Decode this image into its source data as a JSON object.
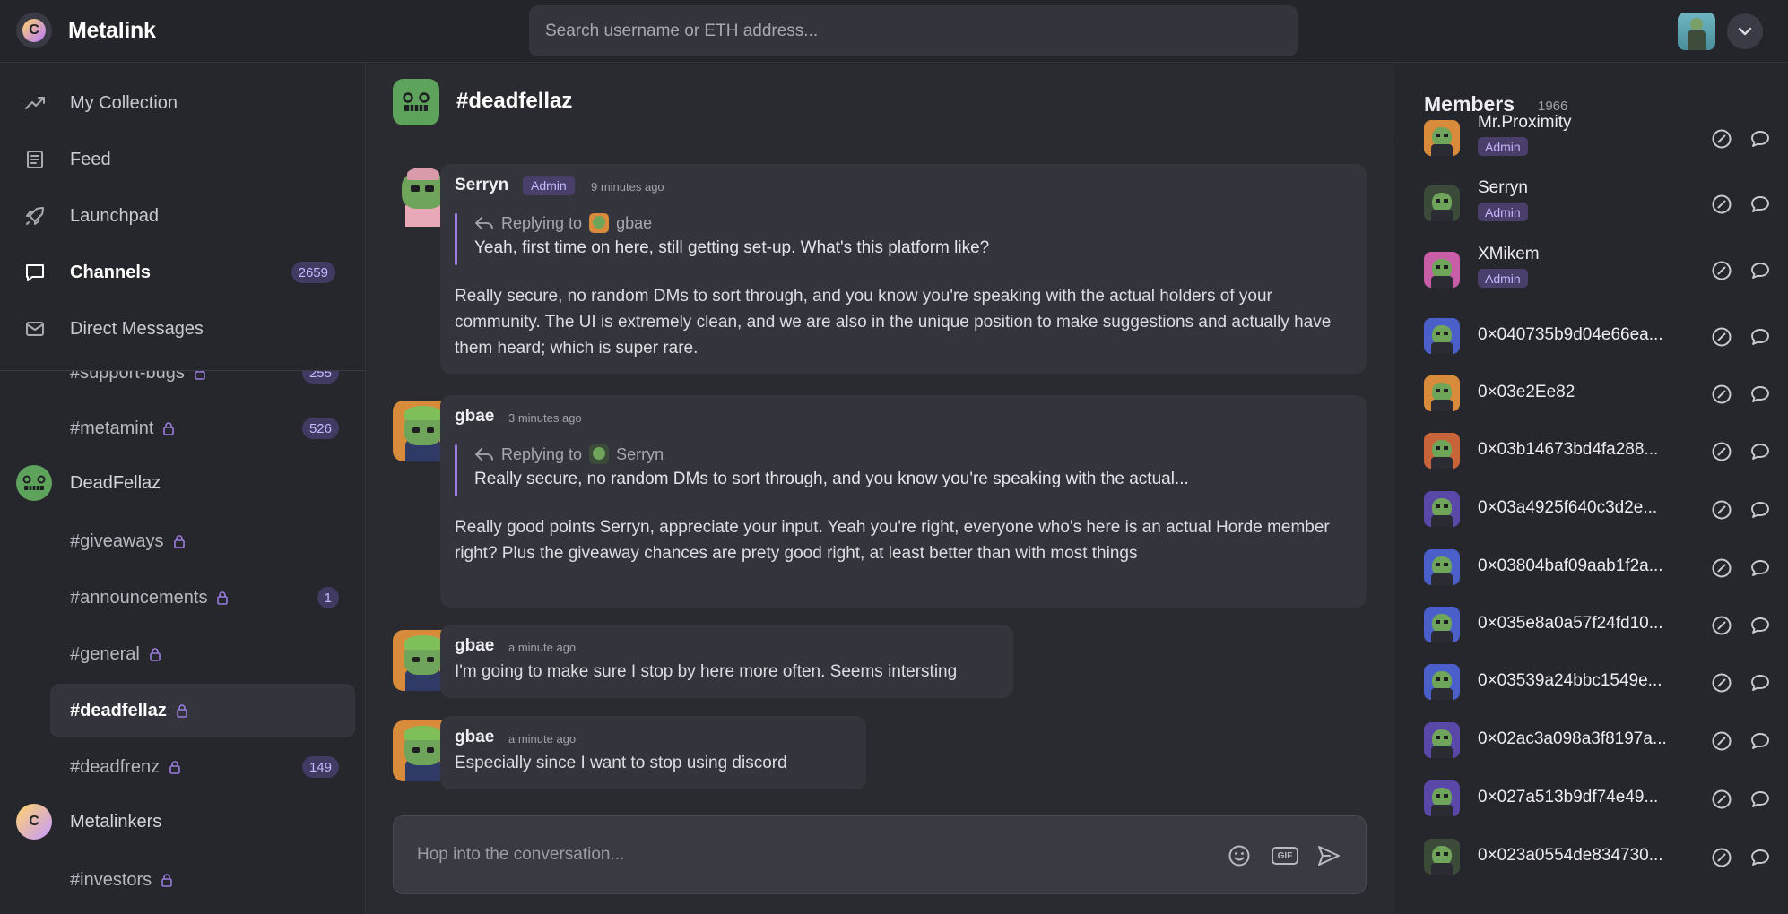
{
  "app": {
    "brand": "Metalink",
    "logo_icon": "metalink-logo-icon",
    "search_placeholder": "Search username or ETH address..."
  },
  "colors": {
    "accent": "#9b7ce0",
    "badge_bg": "#4a3f6b",
    "badge_text": "#c9b6ff",
    "background": "#26262d"
  },
  "nav": [
    {
      "label": "My Collection",
      "icon": "trending-up-icon"
    },
    {
      "label": "Feed",
      "icon": "newspaper-icon"
    },
    {
      "label": "Launchpad",
      "icon": "rocket-icon"
    },
    {
      "label": "Channels",
      "icon": "chat-bubble-icon",
      "count": "2659"
    },
    {
      "label": "Direct Messages",
      "icon": "mail-icon"
    }
  ],
  "channel_list": {
    "partial_top": {
      "name": "#support-bugs",
      "count": "255"
    },
    "metamint": {
      "name": "#metamint",
      "count": "526"
    },
    "group_deadfellaz": "DeadFellaz",
    "giveaways": {
      "name": "#giveaways"
    },
    "announcements": {
      "name": "#announcements",
      "count": "1"
    },
    "general": {
      "name": "#general"
    },
    "deadfellaz": {
      "name": "#deadfellaz"
    },
    "deadfrenz": {
      "name": "#deadfrenz",
      "count": "149"
    },
    "group_metalinkers": "Metalinkers",
    "investors": {
      "name": "#investors"
    }
  },
  "chat": {
    "channel_title": "#deadfellaz",
    "messages": [
      {
        "author": "Serryn",
        "role": "Admin",
        "time": "9 minutes ago",
        "reply_prefix": "Replying to",
        "reply_user": "gbae",
        "reply_text": "Yeah, first time on here, still getting set-up. What's this platform like?",
        "body": "Really secure, no random DMs to sort through, and you know you're speaking with the actual holders of your community. The UI is extremely clean, and we are also in the unique position to make suggestions and actually have them heard; which is super rare."
      },
      {
        "author": "gbae",
        "time": "3 minutes ago",
        "reply_prefix": "Replying to",
        "reply_user": "Serryn",
        "reply_text": "Really secure, no random DMs to sort through, and you know you're speaking with the actual...",
        "body": "Really good points Serryn, appreciate your input. Yeah you're right, everyone who's here is an actual Horde member right? Plus the giveaway chances are prety good right, at least better than with most things"
      },
      {
        "author": "gbae",
        "time": "a minute ago",
        "body": "I'm going to make sure I stop by here more often. Seems intersting"
      },
      {
        "author": "gbae",
        "time": "a minute ago",
        "body": "Especially since I want to stop using discord"
      }
    ],
    "composer_placeholder": "Hop into the conversation...",
    "gif_label": "GIF"
  },
  "members": {
    "title": "Members",
    "count": "1966",
    "list": [
      {
        "name": "Mr.Proximity",
        "role": "Admin"
      },
      {
        "name": "Serryn",
        "role": "Admin"
      },
      {
        "name": "XMikem",
        "role": "Admin"
      },
      {
        "name": "0×040735b9d04e66ea..."
      },
      {
        "name": "0×03e2Ee82"
      },
      {
        "name": "0×03b14673bd4fa288..."
      },
      {
        "name": "0×03a4925f640c3d2e..."
      },
      {
        "name": "0×03804baf09aab1f2a..."
      },
      {
        "name": "0×035e8a0a57f24fd10..."
      },
      {
        "name": "0×03539a24bbc1549e..."
      },
      {
        "name": "0×02ac3a098a3f8197a..."
      },
      {
        "name": "0×027a513b9df74e49..."
      },
      {
        "name": "0×023a0554de834730..."
      }
    ]
  }
}
